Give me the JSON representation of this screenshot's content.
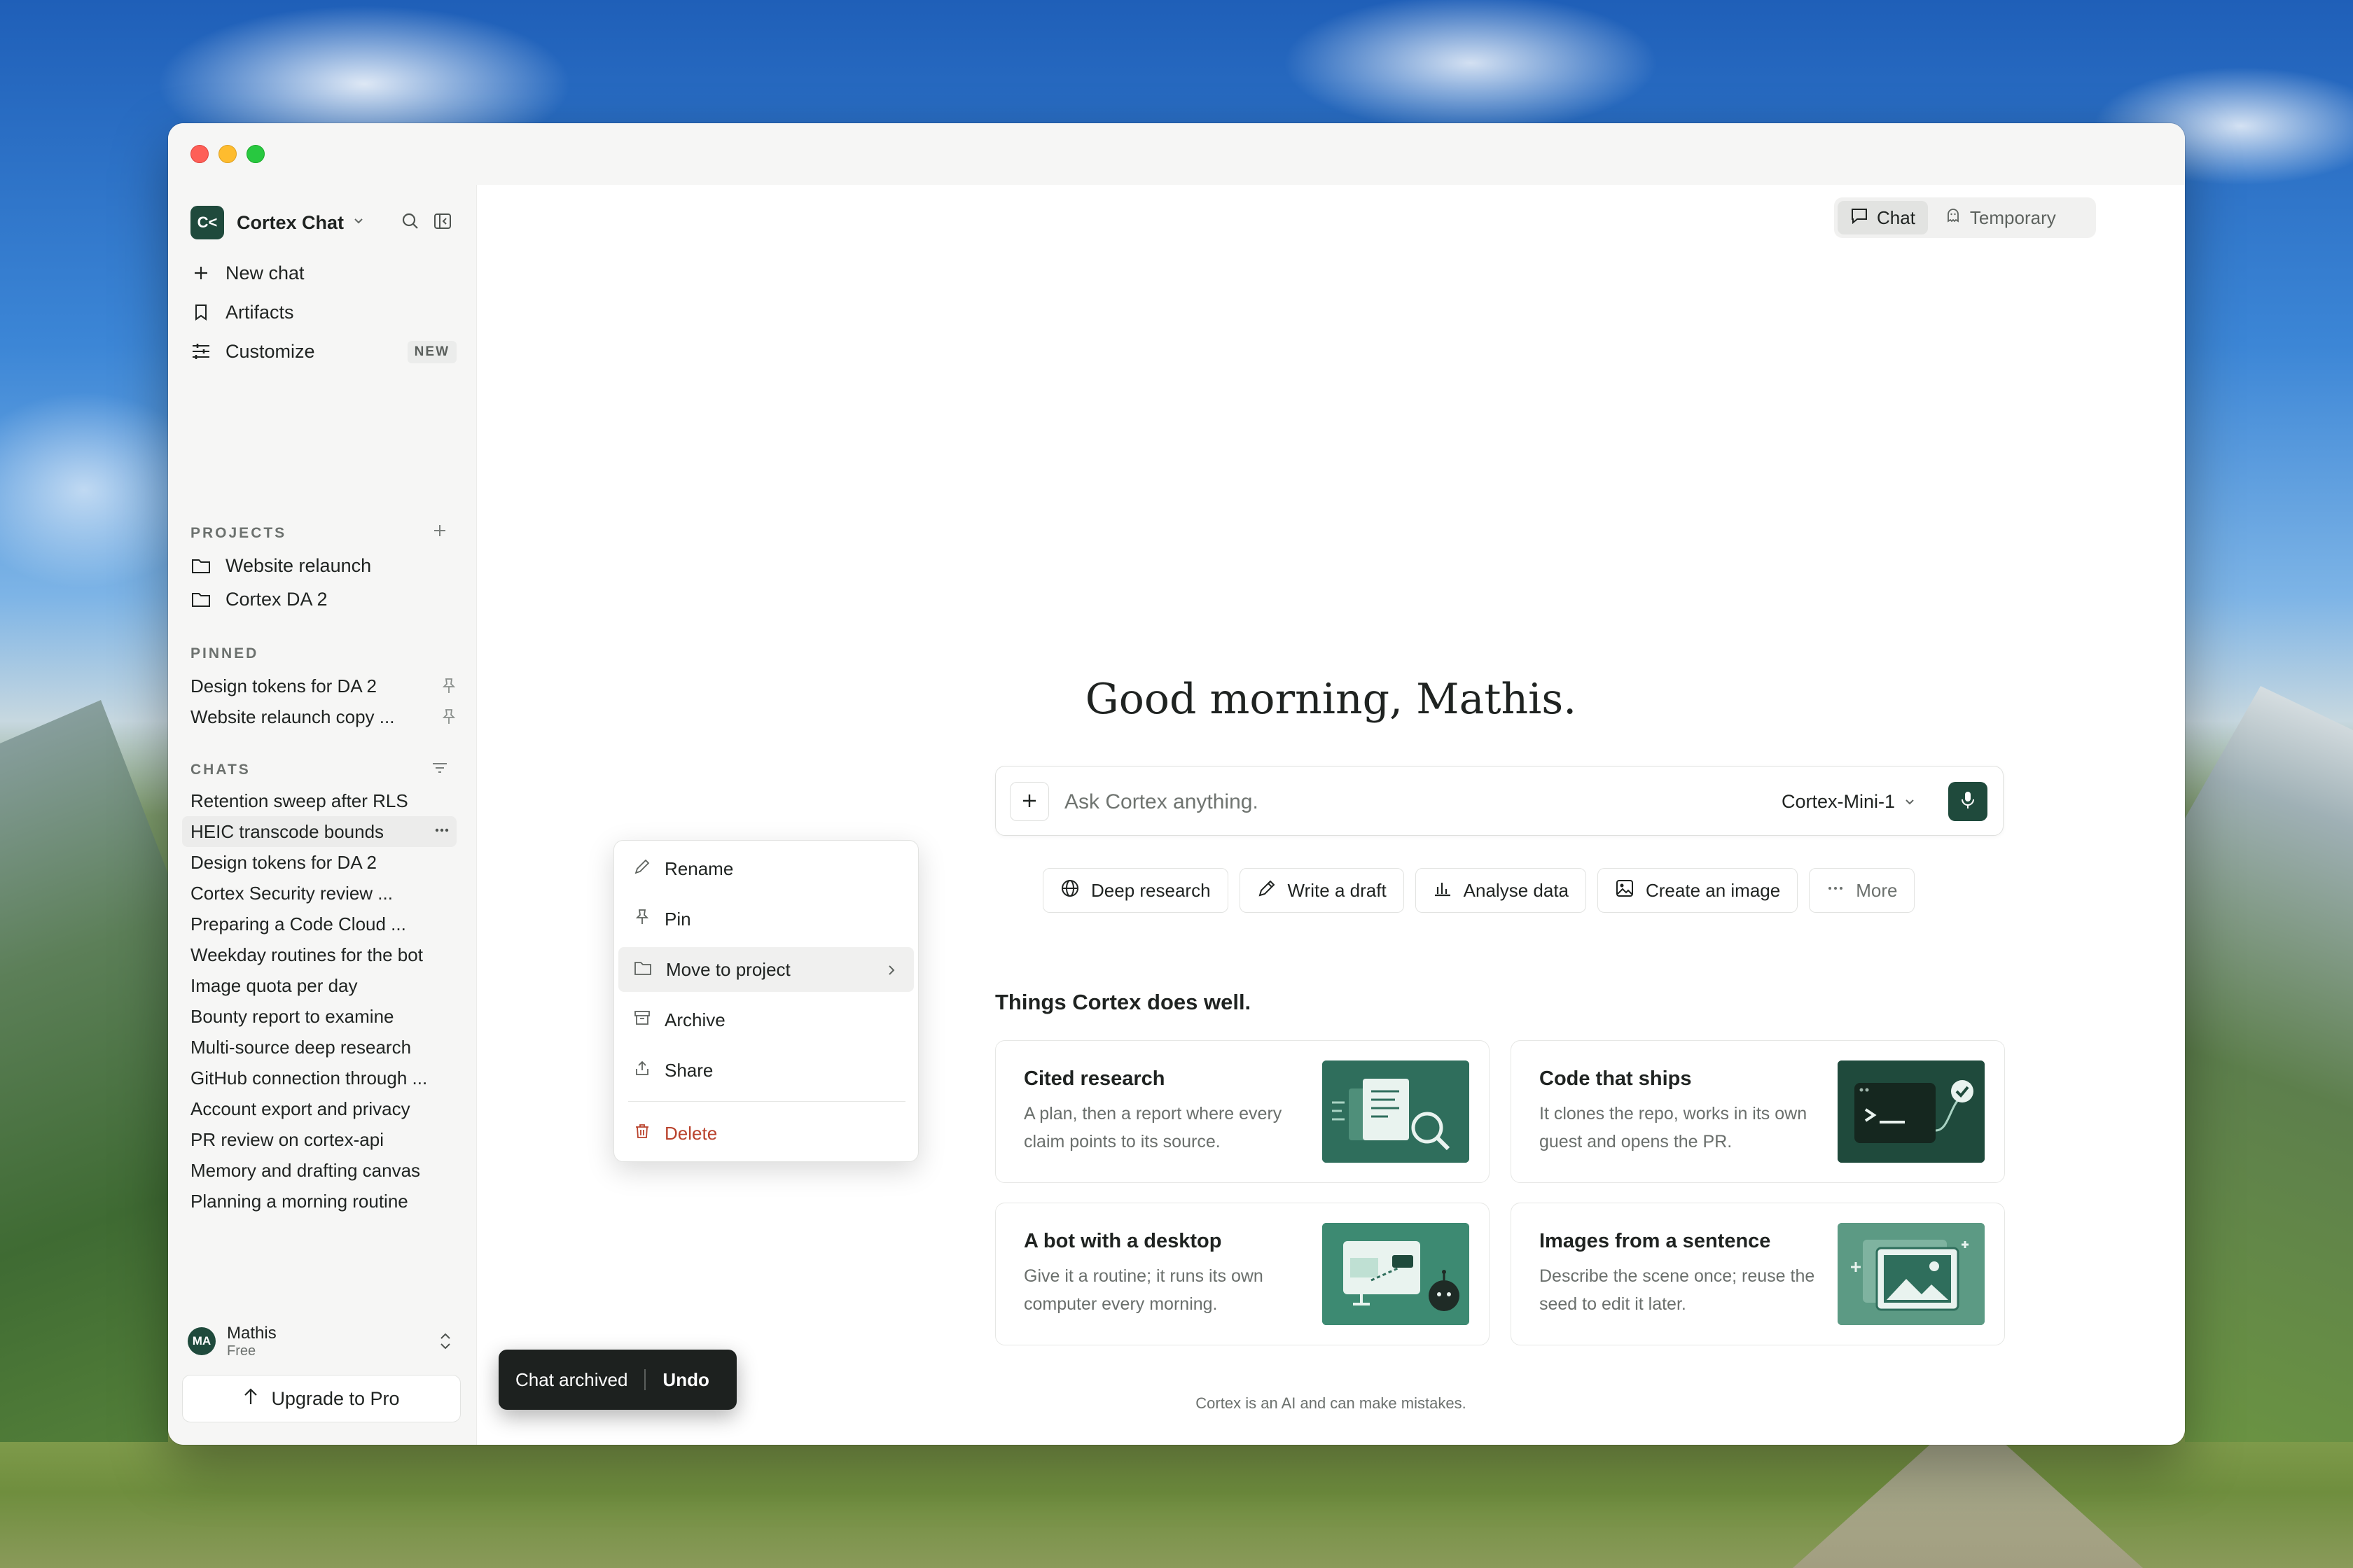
{
  "sidebar": {
    "brand_name": "Cortex Chat",
    "brand_logo_text": "C<",
    "nav": [
      {
        "label": "New chat",
        "icon": "plus-icon"
      },
      {
        "label": "Artifacts",
        "icon": "bookmark-icon"
      },
      {
        "label": "Customize",
        "icon": "sliders-icon",
        "badge": "NEW"
      }
    ],
    "projects_label": "PROJECTS",
    "projects": [
      "Website relaunch",
      "Cortex DA 2"
    ],
    "pinned_label": "PINNED",
    "pinned": [
      "Design tokens for DA 2",
      "Website relaunch copy ..."
    ],
    "chats_label": "CHATS",
    "chats": [
      "Retention sweep after RLS",
      "HEIC transcode bounds",
      "Design tokens for DA 2",
      "Cortex Security review ...",
      "Preparing a Code Cloud ...",
      "Weekday routines for the bot",
      "Image quota per day",
      "Bounty report to examine",
      "Multi-source deep research",
      "GitHub connection through ...",
      "Account export and privacy",
      "PR review on cortex-api",
      "Memory and drafting canvas",
      "Planning a morning routine"
    ],
    "user": {
      "initials": "MA",
      "name": "Mathis",
      "plan": "Free"
    },
    "upgrade_label": "Upgrade to Pro"
  },
  "context_menu": {
    "items": [
      {
        "label": "Rename",
        "icon": "pencil-icon"
      },
      {
        "label": "Pin",
        "icon": "pin-icon"
      },
      {
        "label": "Move to project",
        "icon": "folder-icon"
      },
      {
        "label": "Archive",
        "icon": "archive-icon"
      },
      {
        "label": "Share",
        "icon": "share-icon"
      },
      {
        "label": "Delete",
        "icon": "trash-icon"
      }
    ]
  },
  "main": {
    "modes": [
      {
        "label": "Chat",
        "icon": "chat-bubble-icon"
      },
      {
        "label": "Temporary",
        "icon": "ghost-icon"
      }
    ],
    "greeting": "Good morning, Mathis.",
    "composer": {
      "placeholder": "Ask Cortex anything.",
      "model": "Cortex-Mini-1"
    },
    "actions": [
      {
        "label": "Deep research",
        "icon": "globe-icon"
      },
      {
        "label": "Write a draft",
        "icon": "pen-icon"
      },
      {
        "label": "Analyse data",
        "icon": "bar-chart-icon"
      },
      {
        "label": "Create an image",
        "icon": "image-icon"
      },
      {
        "label": "More",
        "icon": "ellipsis-icon"
      }
    ],
    "features_title": "Things Cortex does well.",
    "cards": [
      {
        "title": "Cited research",
        "desc": "A plan, then a report where every claim points to its source."
      },
      {
        "title": "Code that ships",
        "desc": "It clones the repo, works in its own guest and opens the PR."
      },
      {
        "title": "A bot with a desktop",
        "desc": "Give it a routine; it runs its own computer every morning."
      },
      {
        "title": "Images from a sentence",
        "desc": "Describe the scene once; reuse the seed to edit it later."
      }
    ],
    "footer": "Cortex is an AI and can make mistakes."
  },
  "toast": {
    "message": "Chat archived",
    "action": "Undo"
  },
  "colors": {
    "accent": "#1f4a3c",
    "danger": "#b9422c",
    "sidebar_bg": "#f6f6f5"
  }
}
